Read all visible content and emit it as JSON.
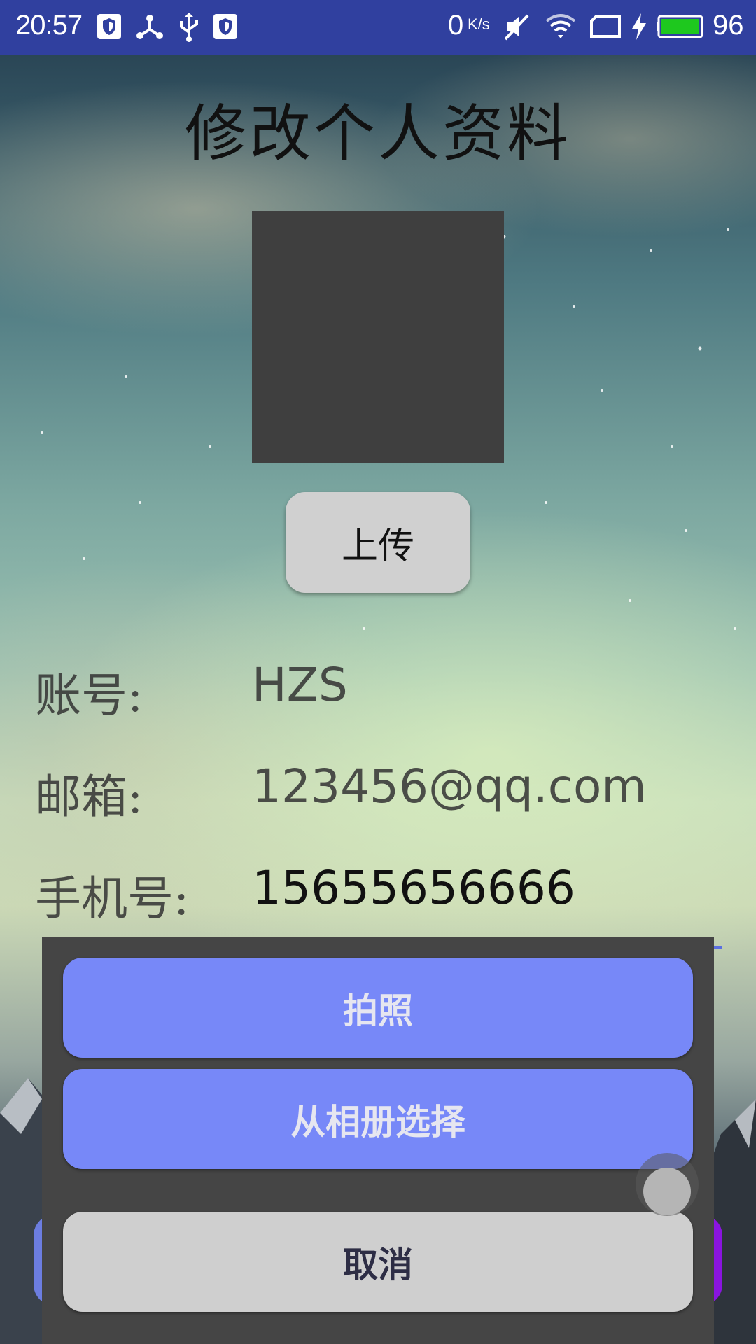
{
  "status_bar": {
    "time": "20:57",
    "net_speed": "0",
    "net_unit": "K/s",
    "battery": "96",
    "icons": [
      "shield-icon",
      "share-icon",
      "usb-icon",
      "shield-icon",
      "mute-icon",
      "wifi-icon",
      "screen-icon",
      "charging-icon",
      "battery-icon"
    ],
    "battery_color": "#1ec81e",
    "bar_color": "#30409f"
  },
  "page": {
    "title": "修改个人资料",
    "upload_label": "上传"
  },
  "fields": [
    {
      "label": "账号:",
      "value": "HZS"
    },
    {
      "label": "邮箱:",
      "value": "123456@qq.com"
    },
    {
      "label": "手机号:",
      "value": "15655656666"
    }
  ],
  "sheet": {
    "take_photo": "拍照",
    "choose_album": "从相册选择",
    "cancel": "取消",
    "accent": "#7788f8"
  }
}
